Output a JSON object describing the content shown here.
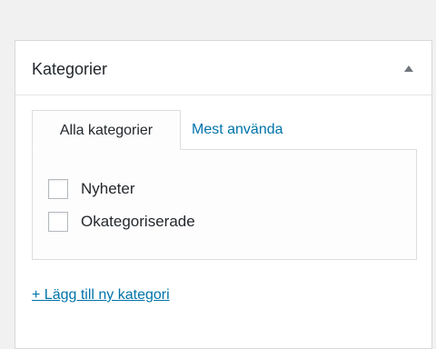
{
  "panel": {
    "title": "Kategorier",
    "toggle_icon": "arrow-up-icon"
  },
  "tabs": [
    {
      "label": "Alla kategorier",
      "active": true
    },
    {
      "label": "Mest använda",
      "active": false
    }
  ],
  "categories": [
    {
      "label": "Nyheter",
      "checked": false
    },
    {
      "label": "Okategoriserade",
      "checked": false
    }
  ],
  "add_link": {
    "label": "+ Lägg till ny kategori"
  },
  "colors": {
    "link": "#0073aa",
    "text": "#23282d",
    "background": "#f1f1f1",
    "border": "#dddddd"
  }
}
